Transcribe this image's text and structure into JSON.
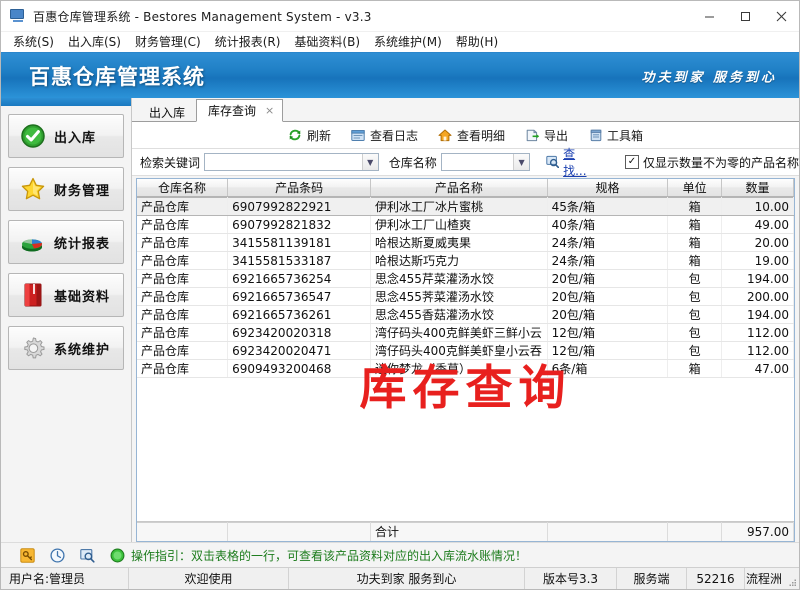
{
  "window": {
    "title": "百惠仓库管理系统 - Bestores Management System - v3.3",
    "icon": "app-window-icon",
    "minimize": "−",
    "maximize": "□",
    "close": "✕"
  },
  "menubar": {
    "items": [
      {
        "label": "系统(S)"
      },
      {
        "label": "出入库(S)"
      },
      {
        "label": "财务管理(C)"
      },
      {
        "label": "统计报表(R)"
      },
      {
        "label": "基础资料(B)"
      },
      {
        "label": "系统维护(M)"
      },
      {
        "label": "帮助(H)"
      }
    ]
  },
  "banner": {
    "title": "百惠仓库管理系统",
    "slogan": "功夫到家 服务到心"
  },
  "sidebar": {
    "items": [
      {
        "label": "出入库",
        "icon": "green-check-icon"
      },
      {
        "label": "财务管理",
        "icon": "yellow-star-icon"
      },
      {
        "label": "统计报表",
        "icon": "pie-chart-icon"
      },
      {
        "label": "基础资料",
        "icon": "red-book-icon"
      },
      {
        "label": "系统维护",
        "icon": "gear-icon"
      }
    ]
  },
  "tabs": [
    {
      "label": "出入库",
      "active": false,
      "closable": false
    },
    {
      "label": "库存查询",
      "active": true,
      "closable": true,
      "close": "×"
    }
  ],
  "toolbar": {
    "buttons": [
      {
        "label": "刷新",
        "icon": "refresh-icon"
      },
      {
        "label": "查看日志",
        "icon": "log-icon"
      },
      {
        "label": "查看明细",
        "icon": "detail-home-icon"
      },
      {
        "label": "导出",
        "icon": "export-icon"
      },
      {
        "label": "工具箱",
        "icon": "toolbox-icon"
      }
    ]
  },
  "filter": {
    "keyword_label": "检索关键词",
    "keyword_value": "",
    "keyword_placeholder": "",
    "warehouse_label": "仓库名称",
    "warehouse_value": "",
    "warehouse_placeholder": "",
    "find_label": "查找...",
    "find_icon": "search-icon",
    "checkbox_label": "仅显示数量不为零的产品名称",
    "checkbox_checked": true,
    "checkbox_mark": "✓"
  },
  "grid": {
    "columns": [
      "仓库名称",
      "产品条码",
      "产品名称",
      "规格",
      "单位",
      "数量"
    ],
    "rows": [
      {
        "warehouse": "产品仓库",
        "barcode": "6907992822921",
        "name": "伊利冰工厂冰片蜜桃",
        "spec": "45条/箱",
        "unit": "箱",
        "qty": "10.00",
        "selected": true
      },
      {
        "warehouse": "产品仓库",
        "barcode": "6907992821832",
        "name": "伊利冰工厂山楂爽",
        "spec": "40条/箱",
        "unit": "箱",
        "qty": "49.00",
        "selected": false
      },
      {
        "warehouse": "产品仓库",
        "barcode": "3415581139181",
        "name": "哈根达斯夏威夷果",
        "spec": "24条/箱",
        "unit": "箱",
        "qty": "20.00",
        "selected": false
      },
      {
        "warehouse": "产品仓库",
        "barcode": "3415581533187",
        "name": "哈根达斯巧克力",
        "spec": "24条/箱",
        "unit": "箱",
        "qty": "19.00",
        "selected": false
      },
      {
        "warehouse": "产品仓库",
        "barcode": "6921665736254",
        "name": "思念455芹菜灌汤水饺",
        "spec": "20包/箱",
        "unit": "包",
        "qty": "194.00",
        "selected": false
      },
      {
        "warehouse": "产品仓库",
        "barcode": "6921665736547",
        "name": "思念455荠菜灌汤水饺",
        "spec": "20包/箱",
        "unit": "包",
        "qty": "200.00",
        "selected": false
      },
      {
        "warehouse": "产品仓库",
        "barcode": "6921665736261",
        "name": "思念455香菇灌汤水饺",
        "spec": "20包/箱",
        "unit": "包",
        "qty": "194.00",
        "selected": false
      },
      {
        "warehouse": "产品仓库",
        "barcode": "6923420020318",
        "name": "湾仔码头400克鲜美虾三鲜小云",
        "spec": "12包/箱",
        "unit": "包",
        "qty": "112.00",
        "selected": false
      },
      {
        "warehouse": "产品仓库",
        "barcode": "6923420020471",
        "name": "湾仔码头400克鲜美虾皇小云吞",
        "spec": "12包/箱",
        "unit": "包",
        "qty": "112.00",
        "selected": false
      },
      {
        "warehouse": "产品仓库",
        "barcode": "6909493200468",
        "name": "迷你梦龙（香草）",
        "spec": "6条/箱",
        "unit": "箱",
        "qty": "47.00",
        "selected": false
      }
    ],
    "total_label": "合计",
    "total_value": "957.00",
    "watermark": "库存查询"
  },
  "tipbar": {
    "icons": [
      "key-icon",
      "clock-icon",
      "search-window-icon",
      "power-icon"
    ],
    "text": "操作指引：双击表格的一行，可查看该产品资料对应的出入库流水账情况！"
  },
  "statusbar": {
    "user": "用户名:管理员",
    "welcome": "欢迎使用",
    "slogan": "功夫到家 服务到心",
    "version": "版本号3.3",
    "server": "服务端",
    "port": "52216",
    "flow": "流程洲"
  },
  "colors": {
    "banner_blue": "#1e7ec4",
    "watermark_red": "#e8201e",
    "tip_green": "#1d7c1d",
    "link_blue": "#1a3fb0"
  }
}
